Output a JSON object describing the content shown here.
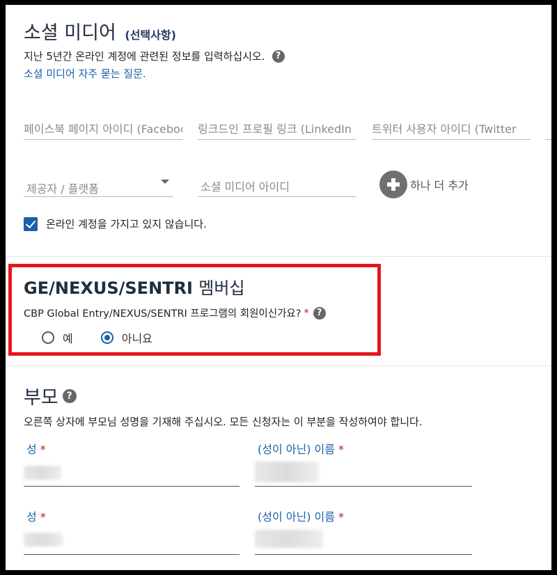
{
  "social": {
    "title": "소셜 미디어",
    "optional": "(선택사항)",
    "description": "지난 5년간 온라인 계정에 관련된 정보를 입력하십시오.",
    "help_icon": "question-circle-icon",
    "faq_link": "소셜 미디어 자주 묻는 질문.",
    "fields": {
      "facebook_placeholder": "페이스북 페이지 아이디 (Facebook",
      "linkedin_placeholder": "링크드인 프로필 링크 (LinkedIn",
      "twitter_placeholder": "트위터 사용자 아이디 (Twitter"
    },
    "provider_placeholder": "제공자 / 플랫폼",
    "social_id_placeholder": "소셜 미디어 아이디",
    "add_more_label": "하나 더 추가",
    "no_account_label": "온라인 계정을 가지고 있지 않습니다.",
    "no_account_checked": true
  },
  "membership": {
    "title_en": "GE/NEXUS/SENTRI",
    "title_kr": "멤버십",
    "question": "CBP Global Entry/NEXUS/SENTRI 프로그램의 회원이신가요?",
    "required_mark": "*",
    "options": [
      {
        "label": "예",
        "selected": false
      },
      {
        "label": "아니요",
        "selected": true
      }
    ]
  },
  "parents": {
    "title": "부모",
    "description": "오른쪽 상자에 부모님 성명을 기재해 주십시오. 모든 신청자는 이 부분을 작성하여야 합니다.",
    "rows": [
      {
        "surname_label": "성",
        "given_label": "(성이 아닌) 이름"
      },
      {
        "surname_label": "성",
        "given_label": "(성이 아닌) 이름"
      }
    ],
    "required_mark": "*"
  },
  "colors": {
    "accent": "#1a5fa8",
    "highlight_border": "#e8141c",
    "required": "#c0152a"
  }
}
